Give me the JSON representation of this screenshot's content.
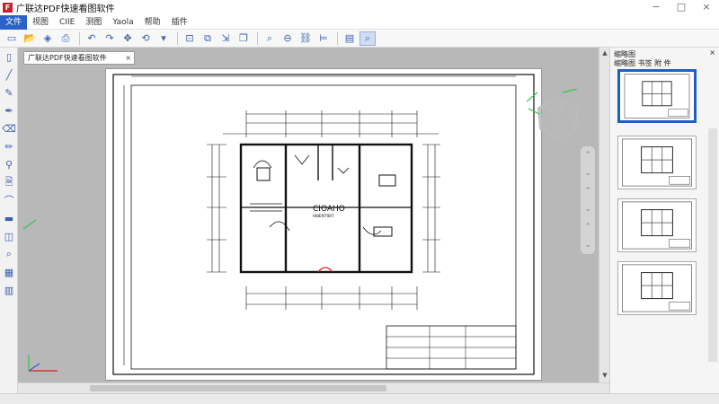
{
  "window": {
    "title": "广联达PDF快速看图软件",
    "logo_text": "F",
    "controls": [
      "−",
      "□",
      "×"
    ]
  },
  "menu": [
    {
      "label": "文件",
      "active": true
    },
    {
      "label": "视图",
      "active": false
    },
    {
      "label": "CIIE",
      "active": false
    },
    {
      "label": "测图",
      "active": false
    },
    {
      "label": "Yaola",
      "active": false
    },
    {
      "label": "帮助",
      "active": false
    },
    {
      "label": "插件",
      "active": false
    }
  ],
  "toolbar": {
    "buttons": [
      {
        "icon": "new-doc-icon",
        "glyph": "▭"
      },
      {
        "icon": "open-folder-icon",
        "glyph": "📂"
      },
      {
        "icon": "save-icon",
        "glyph": "◈"
      },
      {
        "icon": "print-icon",
        "glyph": "⎙"
      },
      {
        "icon": "undo-icon",
        "glyph": "↶"
      },
      {
        "icon": "redo-icon",
        "glyph": "↷"
      },
      {
        "icon": "pan-icon",
        "glyph": "✥"
      },
      {
        "icon": "rotate-icon",
        "glyph": "⟲"
      },
      {
        "icon": "dropdown-icon",
        "glyph": "▾"
      },
      {
        "icon": "measure-icon",
        "glyph": "⊡"
      },
      {
        "icon": "compare-icon",
        "glyph": "⧉"
      },
      {
        "icon": "export-icon",
        "glyph": "⇲"
      },
      {
        "icon": "copy-icon",
        "glyph": "❐"
      },
      {
        "icon": "zoom-icon",
        "glyph": "⌕"
      },
      {
        "icon": "zoom-out-icon",
        "glyph": "⊖"
      },
      {
        "icon": "link-icon",
        "glyph": "⛓"
      },
      {
        "icon": "align-icon",
        "glyph": "⊨"
      },
      {
        "icon": "layers-icon",
        "glyph": "▤"
      },
      {
        "icon": "zoom-selected-icon",
        "glyph": "⌕"
      }
    ]
  },
  "left_tools": [
    {
      "icon": "select-page-icon",
      "glyph": "▯"
    },
    {
      "icon": "line-tool-icon",
      "glyph": "╱"
    },
    {
      "icon": "brush-icon",
      "glyph": "✎"
    },
    {
      "icon": "pen-icon",
      "glyph": "✒"
    },
    {
      "icon": "eraser-icon",
      "glyph": "⌫"
    },
    {
      "icon": "pencil-icon",
      "glyph": "✏"
    },
    {
      "icon": "stamp-icon",
      "glyph": "⚲"
    },
    {
      "icon": "note-icon",
      "glyph": "🗎"
    },
    {
      "icon": "arc-icon",
      "glyph": "⌒"
    },
    {
      "icon": "color-icon",
      "glyph": "▬"
    },
    {
      "icon": "measure-area-icon",
      "glyph": "◫"
    },
    {
      "icon": "search-icon",
      "glyph": "⌕"
    },
    {
      "icon": "grid-icon",
      "glyph": "▦"
    },
    {
      "icon": "table-icon",
      "glyph": "▥"
    }
  ],
  "document": {
    "tab_label": "广联达PDF快速看图软件",
    "tab_close": "×",
    "drawing_title": "CIOAHO",
    "drawing_subtitle": "HIBERITIBIT"
  },
  "thumbnails_panel": {
    "title": "缩略图",
    "subtitle": "缩略图 书签 附 件",
    "close": "×",
    "pages": [
      {
        "selected": true
      },
      {
        "selected": false
      },
      {
        "selected": false
      },
      {
        "selected": false
      }
    ]
  },
  "colors": {
    "accent": "#2a62c9",
    "selection_border": "#1d5fc4",
    "logo": "#c8202a"
  }
}
